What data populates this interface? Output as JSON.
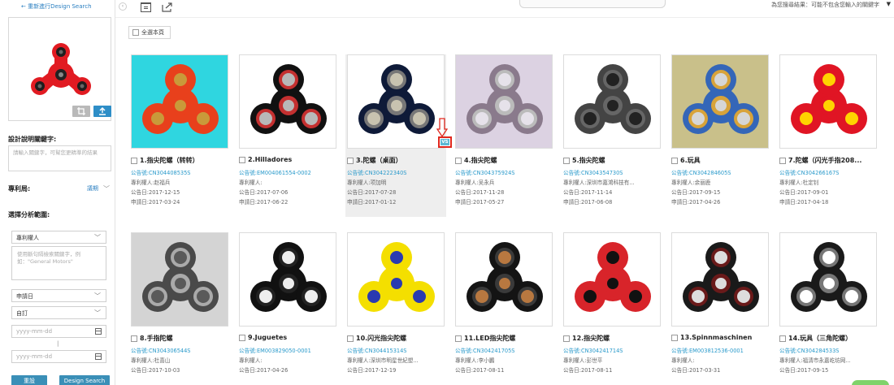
{
  "sidebar": {
    "back_link": "← 重新進行Design Search",
    "keywords_label": "設計說明關鍵字:",
    "keywords_placeholder": "請輸入關鍵字，可幫您更精準的結果",
    "patent_office_label": "專利局:",
    "patent_office_value": "議期",
    "analysis_range_label": "選擇分析範圍:",
    "field_select": "專利權人",
    "field_hint": "使用斷句隔檢索關鍵字，例如：\"General Motors\"",
    "date_type_select": "申請日",
    "date_mode_select": "自訂",
    "date_from_placeholder": "yyyy-mm-dd",
    "date_sep": "|",
    "date_to_placeholder": "yyyy-mm-dd",
    "reset_label": "重設",
    "search_label": "Design Search"
  },
  "toolbar": {
    "collapse_icon": "chevron-left-icon",
    "message": "為您搜尋結果：可能不包含您輸入的關鍵字",
    "user": "▼"
  },
  "main": {
    "select_all_label": "全選本頁",
    "vs_label": "VS",
    "results": [
      {
        "title": "1.指尖陀螺（转转）",
        "pub_no": "公告號:CN304408535S",
        "holder": "專利權人:赵福兵",
        "pub_date": "公告日:2017-12-15",
        "app_date": "申請日:2017-03-24"
      },
      {
        "title": "2.Hilladores",
        "pub_no": "公告號:EM004061554-0002",
        "holder": "專利權人:",
        "pub_date": "公告日:2017-07-06",
        "app_date": "申請日:2017-06-22"
      },
      {
        "title": "3.陀螺（桌面）",
        "pub_no": "公告號:CN304222340S",
        "holder": "專利權人:项加明",
        "pub_date": "公告日:2017-07-28",
        "app_date": "申請日:2017-01-12"
      },
      {
        "title": "4.指尖陀螺",
        "pub_no": "公告號:CN304375924S",
        "holder": "專利權人:吴永兵",
        "pub_date": "公告日:2017-11-28",
        "app_date": "申請日:2017-05-27"
      },
      {
        "title": "5.指尖陀螺",
        "pub_no": "公告號:CN304354730S",
        "holder": "專利權人:深圳市嘉鴻科技有...",
        "pub_date": "公告日:2017-11-14",
        "app_date": "申請日:2017-06-08"
      },
      {
        "title": "6.玩具",
        "pub_no": "公告號:CN304284605S",
        "holder": "專利權人:余丽鹿",
        "pub_date": "公告日:2017-09-15",
        "app_date": "申請日:2017-04-26"
      },
      {
        "title": "7.陀螺（闪光手指208...",
        "pub_no": "公告號:CN304266167S",
        "holder": "專利權人:杜定钊",
        "pub_date": "公告日:2017-09-01",
        "app_date": "申請日:2017-04-18"
      },
      {
        "title": "8.手指陀螺",
        "pub_no": "公告號:CN304306544S",
        "holder": "專利權人:杜喜山",
        "pub_date": "公告日:2017-10-03",
        "app_date": ""
      },
      {
        "title": "9.Juguetes",
        "pub_no": "公告號:EM003829050-0001",
        "holder": "專利權人:",
        "pub_date": "公告日:2017-04-26",
        "app_date": ""
      },
      {
        "title": "10.闪光指尖陀螺",
        "pub_no": "公告號:CN304415314S",
        "holder": "專利權人:深圳市明星世紀塑...",
        "pub_date": "公告日:2017-12-19",
        "app_date": ""
      },
      {
        "title": "11.LED指尖陀螺",
        "pub_no": "公告號:CN304241705S",
        "holder": "專利權人:李小鵬",
        "pub_date": "公告日:2017-08-11",
        "app_date": ""
      },
      {
        "title": "12.指尖陀螺",
        "pub_no": "公告號:CN304241714S",
        "holder": "專利權人:彭世平",
        "pub_date": "公告日:2017-08-11",
        "app_date": ""
      },
      {
        "title": "13.Spinnmaschinen",
        "pub_no": "公告號:EM003812536-0001",
        "holder": "專利權人:",
        "pub_date": "公告日:2017-03-31",
        "app_date": ""
      },
      {
        "title": "14.玩具（三角陀螺）",
        "pub_no": "公告號:CN304284533S",
        "holder": "專利權人:福清市永嘉屹坊网...",
        "pub_date": "公告日:2017-09-15",
        "app_date": ""
      }
    ]
  },
  "colors": {
    "accent": "#2e8ec7",
    "link": "#2a9acb",
    "annotation": "#e0281e"
  },
  "thumbnails": [
    {
      "bg": "#2fd6e0",
      "body": "#e8401c",
      "bearing": "#c99a3a",
      "ring": "#e8401c"
    },
    {
      "bg": "#ffffff",
      "body": "#111111",
      "bearing": "#b8b8b8",
      "ring": "#c43030"
    },
    {
      "bg": "#ffffff",
      "body": "#0e1a38",
      "bearing": "#c8c3b0",
      "ring": "#777"
    },
    {
      "bg": "#dcd2e2",
      "body": "#8a7a8c",
      "bearing": "#e6e2ea",
      "ring": "#bbb"
    },
    {
      "bg": "#ffffff",
      "body": "#444444",
      "bearing": "#222222",
      "ring": "#666"
    },
    {
      "bg": "#c9c08a",
      "body": "#3466b8",
      "bearing": "#d6d6d6",
      "ring": "#d8a33a"
    },
    {
      "bg": "#ffffff",
      "body": "#e01524",
      "bearing": "#ffd400",
      "ring": "#e01524"
    },
    {
      "bg": "#d4d4d4",
      "body": "#4a4a4a",
      "bearing": "#5a5a5a",
      "ring": "#aaa"
    },
    {
      "bg": "#ffffff",
      "body": "#111111",
      "bearing": "#eeeeee",
      "ring": "#222"
    },
    {
      "bg": "#ffffff",
      "body": "#f4df00",
      "bearing": "#2a3ab0",
      "ring": "#f4df00"
    },
    {
      "bg": "#ffffff",
      "body": "#141414",
      "bearing": "#b87840",
      "ring": "#3a3a3a"
    },
    {
      "bg": "#ffffff",
      "body": "#d8242a",
      "bearing": "#111111",
      "ring": "#d8242a"
    },
    {
      "bg": "#ffffff",
      "body": "#1a1a1a",
      "bearing": "#dddddd",
      "ring": "#6a1a1a"
    },
    {
      "bg": "#ffffff",
      "body": "#1a1a1a",
      "bearing": "#ffffff",
      "ring": "#777"
    }
  ]
}
